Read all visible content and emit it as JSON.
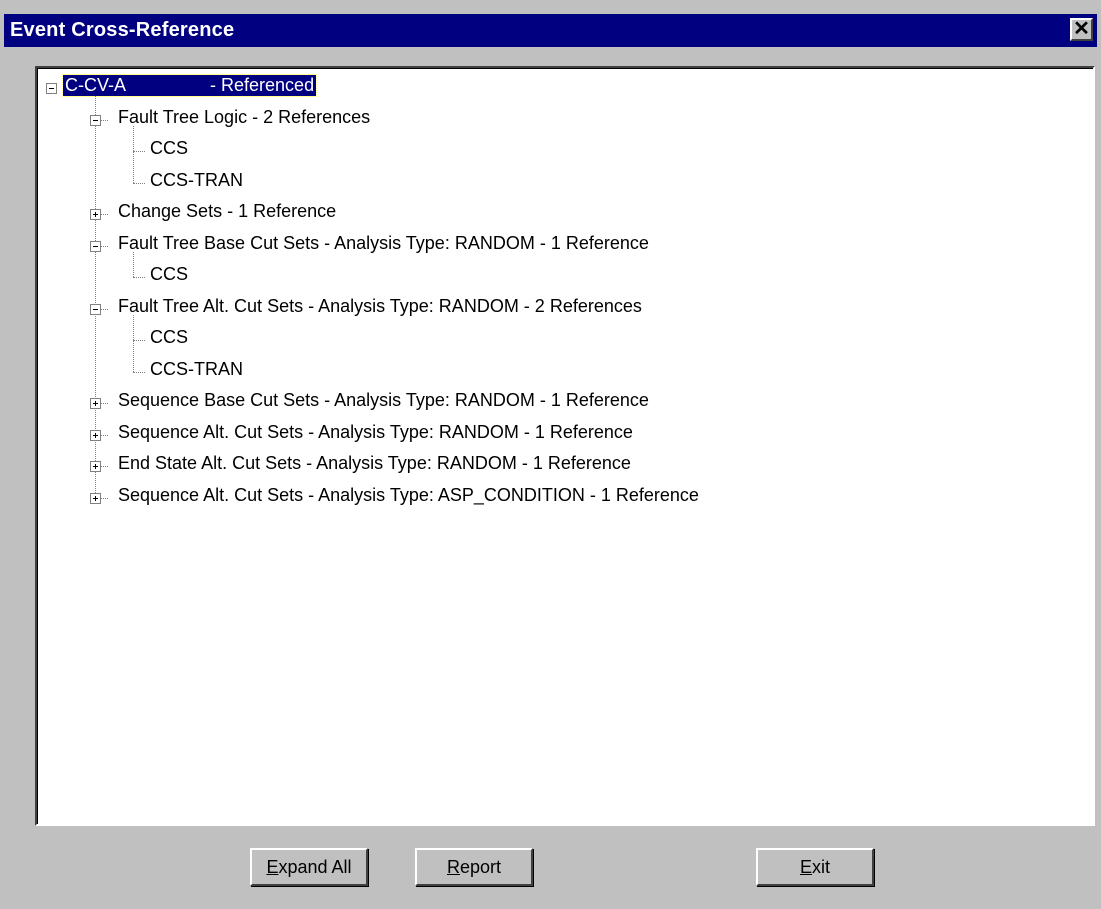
{
  "window": {
    "title": "Event Cross-Reference",
    "close_glyph": "✕"
  },
  "tree": {
    "root": {
      "label": "C-CV-A                 - Referenced",
      "expanded": true,
      "selected": true
    },
    "nodes": [
      {
        "label": "Fault Tree Logic - 2 References",
        "expanded": true,
        "children": [
          "CCS",
          "CCS-TRAN"
        ]
      },
      {
        "label": "Change Sets - 1 Reference",
        "expanded": false
      },
      {
        "label": "Fault Tree Base Cut Sets - Analysis Type: RANDOM - 1 Reference",
        "expanded": true,
        "children": [
          "CCS"
        ]
      },
      {
        "label": "Fault Tree Alt. Cut Sets - Analysis Type: RANDOM - 2 References",
        "expanded": true,
        "children": [
          "CCS",
          "CCS-TRAN"
        ]
      },
      {
        "label": "Sequence Base Cut Sets - Analysis Type: RANDOM - 1 Reference",
        "expanded": false
      },
      {
        "label": "Sequence Alt. Cut Sets - Analysis Type: RANDOM - 1 Reference",
        "expanded": false
      },
      {
        "label": "End State Alt. Cut Sets - Analysis Type: RANDOM - 1 Reference",
        "expanded": false
      },
      {
        "label": "Sequence Alt. Cut Sets - Analysis Type: ASP_CONDITION - 1 Reference",
        "expanded": false
      }
    ]
  },
  "buttons": {
    "expand_all": {
      "mnemonic": "E",
      "rest": "xpand All"
    },
    "report": {
      "mnemonic": "R",
      "rest": "eport"
    },
    "exit": {
      "mnemonic": "E",
      "rest": "xit"
    }
  }
}
